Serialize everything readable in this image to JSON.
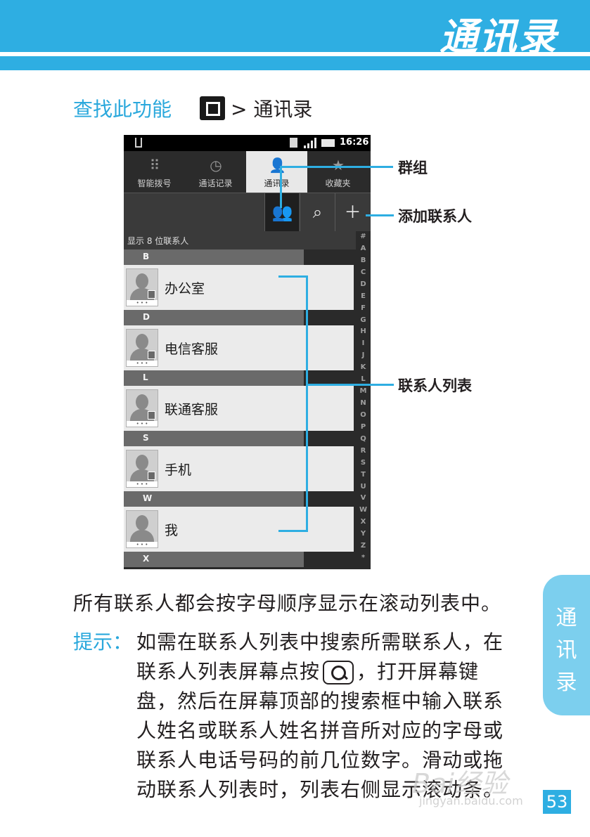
{
  "header": {
    "title": "通讯录"
  },
  "find": {
    "label": "查找此功能",
    "path": "> 通讯录"
  },
  "phone": {
    "status_time": "16:26",
    "tabs": [
      {
        "label": "智能拨号",
        "icon": "dialpad-icon"
      },
      {
        "label": "通话记录",
        "icon": "clock-icon"
      },
      {
        "label": "通讯录",
        "icon": "contacts-icon",
        "active": true
      },
      {
        "label": "收藏夹",
        "icon": "star-icon"
      }
    ],
    "count_text": "显示 8 位联系人",
    "sections": [
      {
        "letter": "B",
        "contacts": [
          "办公室"
        ]
      },
      {
        "letter": "D",
        "contacts": [
          "电信客服"
        ]
      },
      {
        "letter": "L",
        "contacts": [
          "联通客服"
        ]
      },
      {
        "letter": "S",
        "contacts": [
          "手机"
        ]
      },
      {
        "letter": "W",
        "contacts": [
          "我"
        ]
      },
      {
        "letter": "X",
        "contacts": []
      }
    ],
    "avatar_dots": "• • •",
    "alpha_index": [
      "#",
      "A",
      "B",
      "C",
      "D",
      "E",
      "F",
      "G",
      "H",
      "I",
      "J",
      "K",
      "L",
      "M",
      "N",
      "O",
      "P",
      "Q",
      "R",
      "S",
      "T",
      "U",
      "V",
      "W",
      "X",
      "Y",
      "Z",
      "*"
    ]
  },
  "callouts": {
    "groups": "群组",
    "add_contact": "添加联系人",
    "contact_list": "联系人列表"
  },
  "body": {
    "intro": "所有联系人都会按字母顺序显示在滚动列表中。",
    "tip_label": "提示：",
    "tip_line1": "如需在联系人列表中搜索所需联系人，在",
    "tip_line2a": "联系人列表屏幕点按",
    "tip_line2b": "，打开屏幕键",
    "tip_line3": "盘，然后在屏幕顶部的搜索框中输入联系",
    "tip_line4": "人姓名或联系人姓名拼音所对应的字母或",
    "tip_line5": "联系人电话号码的前几位数字。滑动或拖",
    "tip_line6": "动联系人列表时，列表右侧显示滚动条。"
  },
  "side_tab": [
    "通",
    "讯",
    "录"
  ],
  "page_number": "53",
  "watermark": {
    "text": "Bai经验",
    "url": "jingyan.baidu.com"
  }
}
